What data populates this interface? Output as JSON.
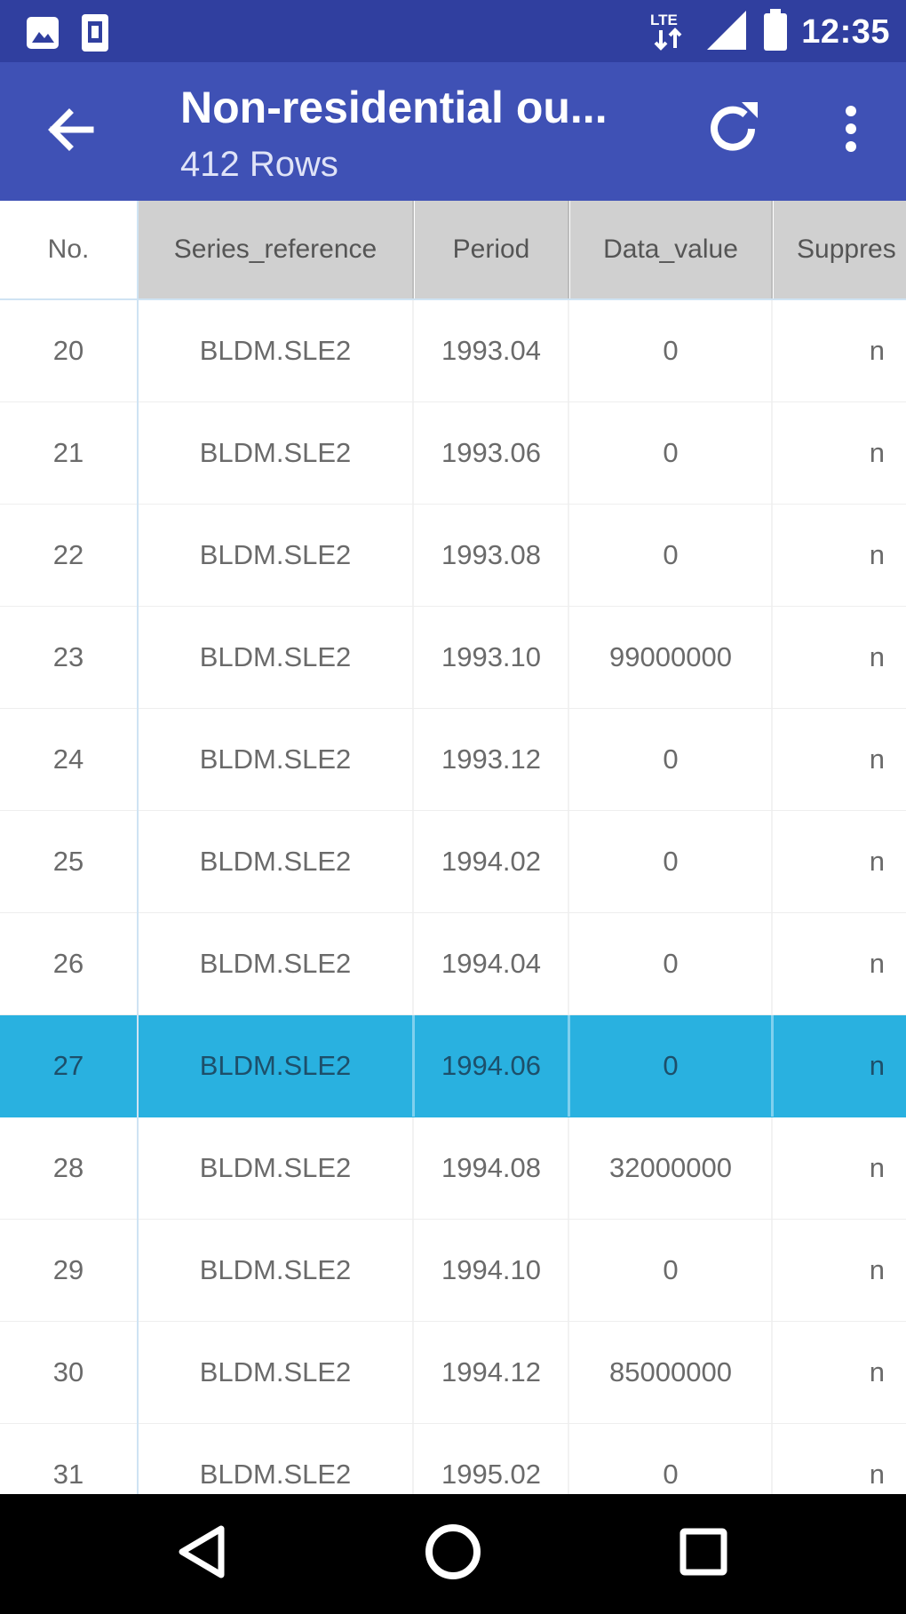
{
  "status_bar": {
    "time": "12:35",
    "network_label": "LTE",
    "icons": [
      "image-icon",
      "sim-card-icon",
      "lte-icon",
      "signal-icon",
      "battery-icon"
    ]
  },
  "app_bar": {
    "title": "Non-residential ou...",
    "subtitle": "412 Rows",
    "colors": {
      "bar": "#3f51b5",
      "status": "#303f9f"
    }
  },
  "table": {
    "columns": [
      "No.",
      "Series_reference",
      "Period",
      "Data_value",
      "Suppres"
    ],
    "selected_row_no": "27",
    "selected_color": "#29b1e0",
    "rows": [
      {
        "no": "20",
        "series_reference": "BLDM.SLE2",
        "period": "1993.04",
        "data_value": "0",
        "suppressed": "n"
      },
      {
        "no": "21",
        "series_reference": "BLDM.SLE2",
        "period": "1993.06",
        "data_value": "0",
        "suppressed": "n"
      },
      {
        "no": "22",
        "series_reference": "BLDM.SLE2",
        "period": "1993.08",
        "data_value": "0",
        "suppressed": "n"
      },
      {
        "no": "23",
        "series_reference": "BLDM.SLE2",
        "period": "1993.10",
        "data_value": "99000000",
        "suppressed": "n"
      },
      {
        "no": "24",
        "series_reference": "BLDM.SLE2",
        "period": "1993.12",
        "data_value": "0",
        "suppressed": "n"
      },
      {
        "no": "25",
        "series_reference": "BLDM.SLE2",
        "period": "1994.02",
        "data_value": "0",
        "suppressed": "n"
      },
      {
        "no": "26",
        "series_reference": "BLDM.SLE2",
        "period": "1994.04",
        "data_value": "0",
        "suppressed": "n"
      },
      {
        "no": "27",
        "series_reference": "BLDM.SLE2",
        "period": "1994.06",
        "data_value": "0",
        "suppressed": "n"
      },
      {
        "no": "28",
        "series_reference": "BLDM.SLE2",
        "period": "1994.08",
        "data_value": "32000000",
        "suppressed": "n"
      },
      {
        "no": "29",
        "series_reference": "BLDM.SLE2",
        "period": "1994.10",
        "data_value": "0",
        "suppressed": "n"
      },
      {
        "no": "30",
        "series_reference": "BLDM.SLE2",
        "period": "1994.12",
        "data_value": "85000000",
        "suppressed": "n"
      },
      {
        "no": "31",
        "series_reference": "BLDM.SLE2",
        "period": "1995.02",
        "data_value": "0",
        "suppressed": "n"
      }
    ]
  },
  "nav_bar": {
    "icons": [
      "back-triangle-icon",
      "home-circle-icon",
      "recents-square-icon"
    ]
  }
}
